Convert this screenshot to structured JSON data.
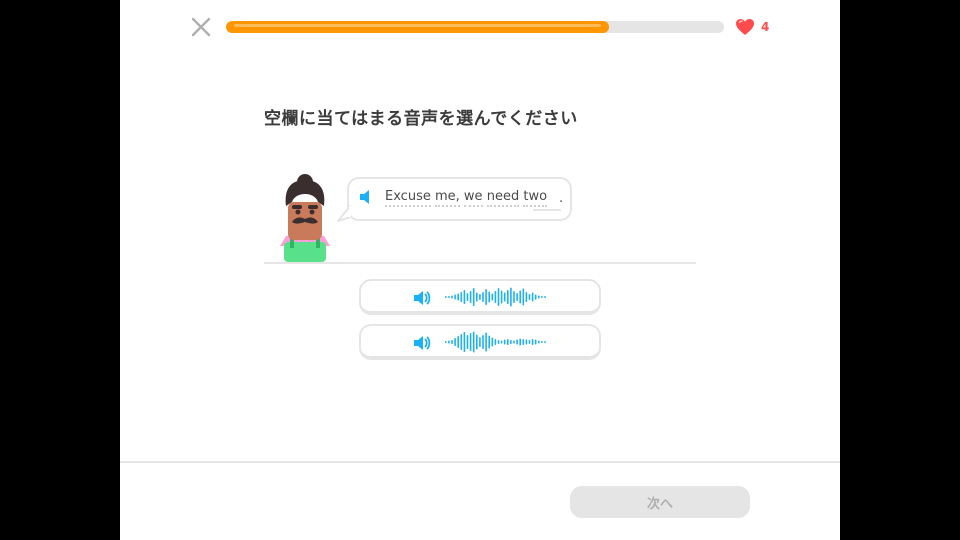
{
  "header": {
    "close_icon": "close-icon",
    "progress": 0.77,
    "progress_color": "#ff9600",
    "hearts_count": "4",
    "hearts_color": "#ff4b4b"
  },
  "challenge": {
    "prompt": "空欄に当てはまる音声を選んでください",
    "speaker_icon": "speaker-icon",
    "sentence_words": [
      "Excuse",
      "me,",
      "we",
      "need",
      "two"
    ],
    "sentence_end": ".",
    "accent_color": "#1cb0f6"
  },
  "options": [
    {
      "icon": "speaker-icon",
      "waveform": "waveform-icon"
    },
    {
      "icon": "speaker-icon",
      "waveform": "waveform-icon"
    }
  ],
  "footer": {
    "next_label": "次へ"
  }
}
